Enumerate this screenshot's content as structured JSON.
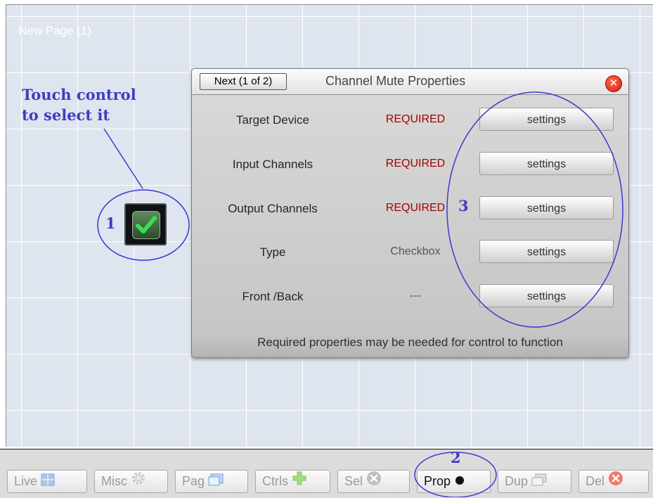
{
  "page": {
    "title": "New Page (1)"
  },
  "annotations": {
    "touch_note_line1": "Touch control",
    "touch_note_line2": "to select it",
    "marker1": "1",
    "marker2": "2",
    "marker3": "3",
    "ellipse_color": "#3a3ad0"
  },
  "dialog": {
    "next_label": "Next (1 of 2)",
    "title": "Channel Mute Properties",
    "close_icon": "close-icon",
    "rows": [
      {
        "label": "Target Device",
        "value": "REQUIRED",
        "button": "settings"
      },
      {
        "label": "Input Channels",
        "value": "REQUIRED",
        "button": "settings"
      },
      {
        "label": "Output Channels",
        "value": "REQUIRED",
        "button": "settings"
      },
      {
        "label": "Type",
        "value": "Checkbox",
        "button": "settings"
      },
      {
        "label": "Front /Back",
        "value": "---",
        "button": "settings"
      }
    ],
    "footer": "Required properties may be needed for control to function",
    "colors": {
      "required": "#a30000",
      "normal_value": "#555555"
    }
  },
  "toolbar": {
    "buttons": [
      {
        "label": "Live",
        "icon": "grid-icon"
      },
      {
        "label": "Misc",
        "icon": "gear-icon"
      },
      {
        "label": "Pag",
        "icon": "window-icon"
      },
      {
        "label": "Ctrls",
        "icon": "plus-icon"
      },
      {
        "label": "Sel",
        "icon": "x-circle-icon"
      },
      {
        "label": "Prop",
        "icon": "dot-icon"
      },
      {
        "label": "Dup",
        "icon": "duplicate-icon"
      },
      {
        "label": "Del",
        "icon": "delete-icon"
      }
    ]
  }
}
